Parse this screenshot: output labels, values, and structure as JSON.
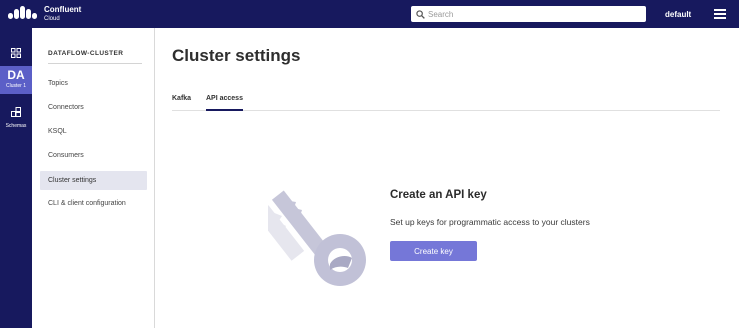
{
  "brand": {
    "name": "Confluent",
    "sub": "Cloud"
  },
  "search": {
    "placeholder": "Search",
    "value": ""
  },
  "environment": "default",
  "rail": {
    "cluster_abbr": "DA",
    "cluster_label": "Cluster 1",
    "schemas_label": "Schemas"
  },
  "sidenav": {
    "cluster_name": "DATAFLOW-CLUSTER",
    "items": [
      {
        "label": "Topics"
      },
      {
        "label": "Connectors"
      },
      {
        "label": "KSQL"
      },
      {
        "label": "Consumers"
      },
      {
        "label": "Cluster settings",
        "active": true
      },
      {
        "label": "CLI & client configuration"
      }
    ]
  },
  "main": {
    "title": "Cluster settings",
    "tabs": [
      {
        "label": "Kafka"
      },
      {
        "label": "API access",
        "active": true
      }
    ],
    "empty_state": {
      "title": "Create an API key",
      "description": "Set up keys for programmatic access to your clusters",
      "button": "Create key"
    }
  },
  "colors": {
    "topbar": "#17195e",
    "accent": "#5b5fc7",
    "button": "#7577d8",
    "active_nav_bg": "#e4e5ef"
  }
}
